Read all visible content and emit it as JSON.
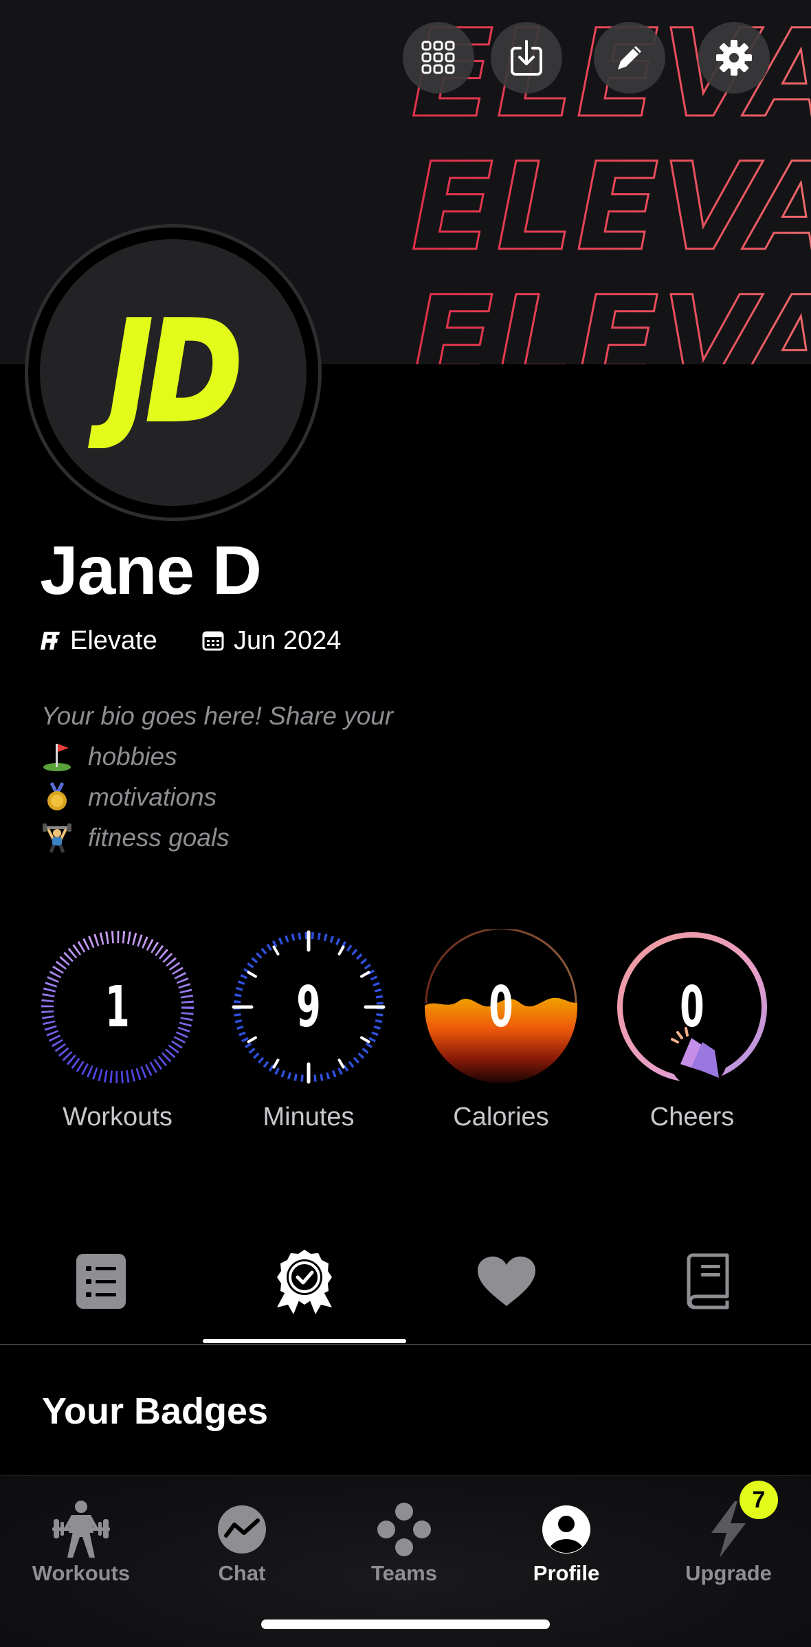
{
  "banner": {
    "word": "ELEVATE"
  },
  "top_actions": {
    "grid": "grid-icon",
    "download": "download-icon",
    "edit": "edit-icon",
    "settings": "gear-icon"
  },
  "profile": {
    "initials": "JD",
    "name": "Jane D",
    "team": "Elevate",
    "joined": "Jun 2024",
    "bio": {
      "intro": "Your bio goes here! Share your",
      "items": [
        "hobbies",
        "motivations",
        "fitness goals"
      ]
    }
  },
  "stats": [
    {
      "label": "Workouts",
      "value": "1"
    },
    {
      "label": "Minutes",
      "value": "9"
    },
    {
      "label": "Calories",
      "value": "0"
    },
    {
      "label": "Cheers",
      "value": "0"
    }
  ],
  "tabs": [
    {
      "icon": "list-icon",
      "active": false
    },
    {
      "icon": "badge-award-icon",
      "active": true
    },
    {
      "icon": "heart-icon",
      "active": false
    },
    {
      "icon": "book-icon",
      "active": false
    }
  ],
  "section": {
    "title": "Your Badges"
  },
  "nav": {
    "items": [
      {
        "label": "Workouts",
        "icon": "weightlifter-icon"
      },
      {
        "label": "Chat",
        "icon": "chat-icon"
      },
      {
        "label": "Teams",
        "icon": "teams-icon"
      },
      {
        "label": "Profile",
        "icon": "profile-icon"
      },
      {
        "label": "Upgrade",
        "icon": "bolt-icon"
      }
    ],
    "upgrade_badge": "7"
  },
  "colors": {
    "accent": "#e2fb1a",
    "banner_red": "#e0304a",
    "banner_peach": "#f29a85",
    "workouts_ring": "#9b7bf5",
    "minutes_ring": "#2f4fd9",
    "cheers_ring": "#ea9ab0"
  }
}
